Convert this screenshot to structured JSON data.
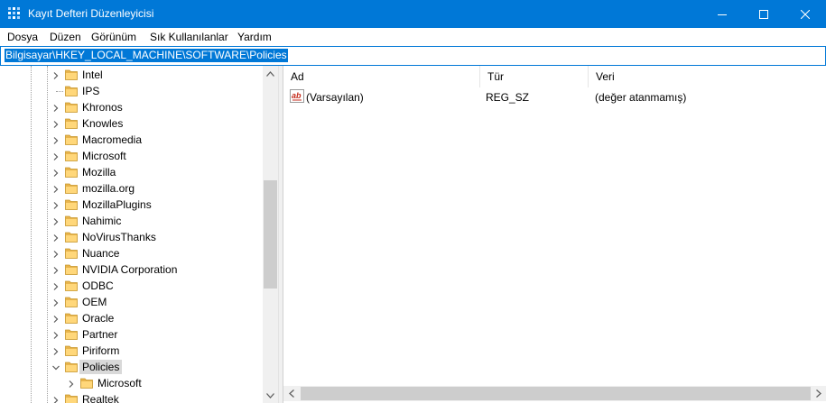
{
  "window": {
    "title": "Kayıt Defteri Düzenleyicisi",
    "accent_color": "#0078d7"
  },
  "menu": [
    "Dosya",
    "Düzen",
    "Görünüm",
    "Sık Kullanılanlar",
    "Yardım"
  ],
  "address": {
    "value": "Bilgisayar\\HKEY_LOCAL_MACHINE\\SOFTWARE\\Policies"
  },
  "tree": {
    "items": [
      {
        "label": "Intel",
        "expander": "collapsed",
        "selected": false
      },
      {
        "label": "IPS",
        "expander": "none",
        "selected": false
      },
      {
        "label": "Khronos",
        "expander": "collapsed",
        "selected": false
      },
      {
        "label": "Knowles",
        "expander": "collapsed",
        "selected": false
      },
      {
        "label": "Macromedia",
        "expander": "collapsed",
        "selected": false
      },
      {
        "label": "Microsoft",
        "expander": "collapsed",
        "selected": false
      },
      {
        "label": "Mozilla",
        "expander": "collapsed",
        "selected": false
      },
      {
        "label": "mozilla.org",
        "expander": "collapsed",
        "selected": false
      },
      {
        "label": "MozillaPlugins",
        "expander": "collapsed",
        "selected": false
      },
      {
        "label": "Nahimic",
        "expander": "collapsed",
        "selected": false
      },
      {
        "label": "NoVirusThanks",
        "expander": "collapsed",
        "selected": false
      },
      {
        "label": "Nuance",
        "expander": "collapsed",
        "selected": false
      },
      {
        "label": "NVIDIA Corporation",
        "expander": "collapsed",
        "selected": false
      },
      {
        "label": "ODBC",
        "expander": "collapsed",
        "selected": false
      },
      {
        "label": "OEM",
        "expander": "collapsed",
        "selected": false
      },
      {
        "label": "Oracle",
        "expander": "collapsed",
        "selected": false
      },
      {
        "label": "Partner",
        "expander": "collapsed",
        "selected": false
      },
      {
        "label": "Piriform",
        "expander": "collapsed",
        "selected": false
      },
      {
        "label": "Policies",
        "expander": "expanded",
        "selected": true
      },
      {
        "label": "Microsoft",
        "expander": "collapsed",
        "selected": false,
        "child": true
      },
      {
        "label": "Realtek",
        "expander": "collapsed",
        "selected": false
      }
    ]
  },
  "list": {
    "columns": [
      "Ad",
      "Tür",
      "Veri"
    ],
    "rows": [
      {
        "icon": "string-value-icon",
        "name": "(Varsayılan)",
        "type": "REG_SZ",
        "data": "(değer atanmamış)"
      }
    ]
  }
}
